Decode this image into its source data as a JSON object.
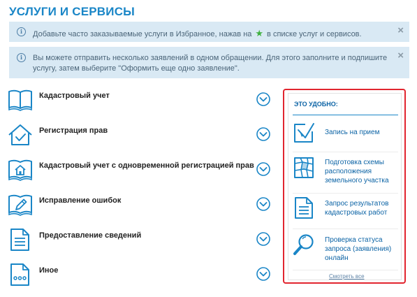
{
  "page": {
    "title": "УСЛУГИ И СЕРВИСЫ"
  },
  "notices": {
    "favorites": {
      "before": "Добавьте часто заказываемые услуги в Избранное, нажав на",
      "after": "в списке услуг и сервисов.",
      "close": "×"
    },
    "multiple": {
      "text": "Вы можете отправить несколько заявлений в одном обращении. Для этого заполните и подпишите услугу, затем выберите \"Оформить еще одно заявление\".",
      "close": "×"
    }
  },
  "services": [
    {
      "label": "Кадастровый учет",
      "icon": "book-icon"
    },
    {
      "label": "Регистрация прав",
      "icon": "house-check-icon"
    },
    {
      "label": "Кадастровый учет с одновременной регистрацией прав",
      "icon": "book-house-icon"
    },
    {
      "label": "Исправление ошибок",
      "icon": "book-pencil-icon"
    },
    {
      "label": "Предоставление сведений",
      "icon": "document-icon"
    },
    {
      "label": "Иное",
      "icon": "document-dots-icon"
    }
  ],
  "convenient": {
    "heading": "ЭТО УДОБНО:",
    "items": [
      {
        "label": "Запись на прием",
        "icon": "appointment-icon"
      },
      {
        "label": "Подготовка схемы расположения земельного участка",
        "icon": "land-plot-icon"
      },
      {
        "label": "Запрос результатов кадастровых работ",
        "icon": "document-lines-icon"
      },
      {
        "label": "Проверка статуса запроса (заявления) онлайн",
        "icon": "magnifier-icon"
      }
    ],
    "see_all": "Смотреть все"
  },
  "colors": {
    "accent": "#1a86c7",
    "dark_accent": "#0b63a5",
    "highlight_border": "#e1252f",
    "notice_bg": "#d9e9f4",
    "star": "#3fb13f"
  }
}
